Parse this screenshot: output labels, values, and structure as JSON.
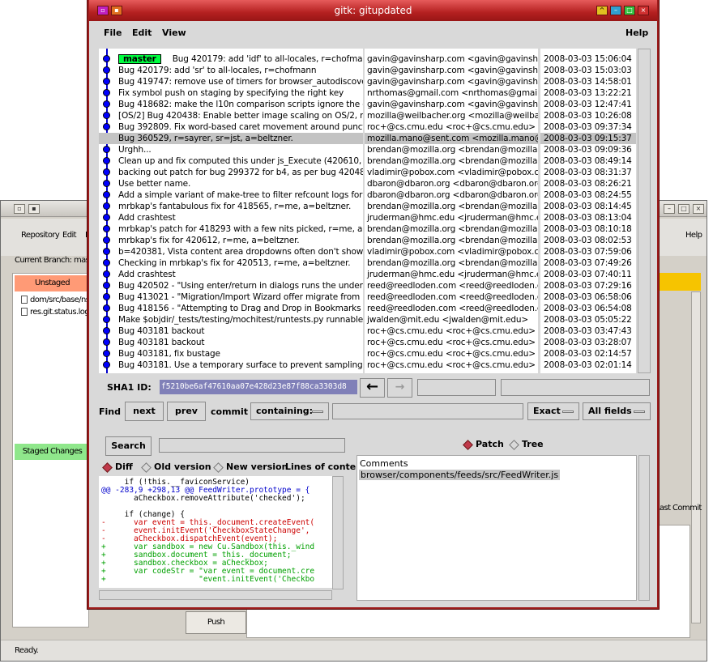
{
  "background_window": {
    "menu": [
      "Repository",
      "Edit",
      "Br",
      "Help"
    ],
    "current_branch_label": "Current Branch:",
    "current_branch": "master",
    "unstaged_header": "Unstaged",
    "unstaged_files": [
      "dom/src/base/nsDOMC",
      "res.git.status.log"
    ],
    "staged_header": "Staged Changes",
    "last_commit_label": "Last Commit",
    "push_label": "Push",
    "status": "Ready."
  },
  "gitk": {
    "title": "gitk: gitupdated",
    "menu": {
      "file": "File",
      "edit": "Edit",
      "view": "View",
      "help": "Help"
    },
    "branch_tag": "master",
    "commits": [
      {
        "msg": "Bug 420179: add 'idf' to all-locales, r=chofmann, a=",
        "author": "gavin@gavinsharp.com <gavin@gavinsharp",
        "date": "2008-03-03 15:06:04"
      },
      {
        "msg": "Bug 420179: add 'sr' to all-locales, r=chofmann",
        "author": "gavin@gavinsharp.com <gavin@gavinsharp",
        "date": "2008-03-03 15:03:03"
      },
      {
        "msg": "Bug 419747: remove use of timers for browser_autodiscovery",
        "author": "gavin@gavinsharp.com <gavin@gavinsharp",
        "date": "2008-03-03 14:58:01"
      },
      {
        "msg": "Fix symbol push on staging by specifying the right key",
        "author": "nrthomas@gmail.com <nrthomas@gmail.co",
        "date": "2008-03-03 13:22:21"
      },
      {
        "msg": "Bug 418682: make the l10n comparison scripts ignore the opt",
        "author": "gavin@gavinsharp.com <gavin@gavinsharp",
        "date": "2008-03-03 12:47:41"
      },
      {
        "msg": "[OS/2] Bug 420438: Enable better image scaling on OS/2, r=w",
        "author": "mozilla@weilbacher.org <mozilla@weilbach",
        "date": "2008-03-03 10:26:08"
      },
      {
        "msg": "Bug 392809. Fix word-based caret movement around punctua",
        "author": "roc+@cs.cmu.edu <roc+@cs.cmu.edu>",
        "date": "2008-03-03 09:37:34"
      },
      {
        "msg": "Bug 360529, r=sayrer, sr=jst, a=beltzner.",
        "author": "mozilla.mano@sent.com <mozilla.mano@se",
        "date": "2008-03-03 09:15:37",
        "selected": true
      },
      {
        "msg": "Urghh...",
        "author": "brendan@mozilla.org <brendan@mozilla.org",
        "date": "2008-03-03 09:09:36"
      },
      {
        "msg": "Clean up and fix computed this under js_Execute (420610, r=",
        "author": "brendan@mozilla.org <brendan@mozilla.org",
        "date": "2008-03-03 08:49:14"
      },
      {
        "msg": "backing out patch for bug 299372 for b4, as per bug 420481",
        "author": "vladimir@pobox.com <vladimir@pobox.com",
        "date": "2008-03-03 08:31:37"
      },
      {
        "msg": "Use better name.",
        "author": "dbaron@dbaron.org <dbaron@dbaron.org>",
        "date": "2008-03-03 08:26:21"
      },
      {
        "msg": "Add a simple variant of make-tree to filter refcount logs for a s",
        "author": "dbaron@dbaron.org <dbaron@dbaron.org>",
        "date": "2008-03-03 08:24:55"
      },
      {
        "msg": "mrbkap's fantabulous fix for 418565, r=me, a=beltzner.",
        "author": "brendan@mozilla.org <brendan@mozilla.org",
        "date": "2008-03-03 08:14:45"
      },
      {
        "msg": "Add crashtest",
        "author": "jruderman@hmc.edu <jruderman@hmc.edu",
        "date": "2008-03-03 08:13:04"
      },
      {
        "msg": "mrbkap's patch for 418293 with a few nits picked, r=me, a=bel",
        "author": "brendan@mozilla.org <brendan@mozilla.org",
        "date": "2008-03-03 08:10:18"
      },
      {
        "msg": "mrbkap's fix for 420612, r=me, a=beltzner.",
        "author": "brendan@mozilla.org <brendan@mozilla.org",
        "date": "2008-03-03 08:02:53"
      },
      {
        "msg": "b=420381, Vista content area dropdowns often don't show dro",
        "author": "vladimir@pobox.com <vladimir@pobox.com",
        "date": "2008-03-03 07:59:06"
      },
      {
        "msg": "Checking in mrbkap's fix for 420513, r=me, a=beltzner.",
        "author": "brendan@mozilla.org <brendan@mozilla.org",
        "date": "2008-03-03 07:49:26"
      },
      {
        "msg": "Add crashtest",
        "author": "jruderman@hmc.edu <jruderman@hmc.edu",
        "date": "2008-03-03 07:40:11"
      },
      {
        "msg": "Bug 420502 - \"Using enter/return in dialogs runs the underlyin",
        "author": "reed@reedloden.com <reed@reedloden.co",
        "date": "2008-03-03 07:29:16"
      },
      {
        "msg": "Bug 413021 - \"Migration/Import Wizard offer migrate from IE d",
        "author": "reed@reedloden.com <reed@reedloden.co",
        "date": "2008-03-03 06:58:06"
      },
      {
        "msg": "Bug 418156 - \"Attempting to Drag and Drop in Bookmarks me",
        "author": "reed@reedloden.com <reed@reedloden.co",
        "date": "2008-03-03 06:54:08"
      },
      {
        "msg": "Make $objdir/_tests/testing/mochitest/runtests.py runnable fro",
        "author": "jwalden@mit.edu <jwalden@mit.edu>",
        "date": "2008-03-03 05:05:22"
      },
      {
        "msg": "Bug 403181 backout",
        "author": "roc+@cs.cmu.edu <roc+@cs.cmu.edu>",
        "date": "2008-03-03 03:47:43"
      },
      {
        "msg": "Bug 403181 backout",
        "author": "roc+@cs.cmu.edu <roc+@cs.cmu.edu>",
        "date": "2008-03-03 03:28:07"
      },
      {
        "msg": "Bug 403181, fix bustage",
        "author": "roc+@cs.cmu.edu <roc+@cs.cmu.edu>",
        "date": "2008-03-03 02:14:57"
      },
      {
        "msg": "Bug 403181. Use a temporary surface to prevent sampling of",
        "author": "roc+@cs.cmu.edu <roc+@cs.cmu.edu>",
        "date": "2008-03-03 02:01:14"
      }
    ],
    "sha_label": "SHA1 ID:",
    "sha_value": "f5210be6af47610aa07e428d23e87f88ca3303d8",
    "find": {
      "label": "Find",
      "next": "next",
      "prev": "prev",
      "commit_label": "commit",
      "containing": "containing:",
      "exact": "Exact",
      "all_fields": "All fields"
    },
    "search_label": "Search",
    "diff_options": {
      "diff": "Diff",
      "old": "Old version",
      "new": "New version",
      "lines": "Lines of conte"
    },
    "view_options": {
      "patch": "Patch",
      "tree": "Tree"
    },
    "diff_lines": [
      {
        "t": "     if (!this.__faviconService)",
        "c": "#000000"
      },
      {
        "t": "@@ -283,9 +298,13 @@ FeedWriter.prototype = {",
        "c": "#0000cc"
      },
      {
        "t": "       aCheckbox.removeAttribute('checked');",
        "c": "#000000"
      },
      {
        "t": "",
        "c": "#000000"
      },
      {
        "t": "     if (change) {",
        "c": "#000000"
      },
      {
        "t": "-      var event = this._document.createEvent(",
        "c": "#cc0000"
      },
      {
        "t": "-      event.initEvent('CheckboxStateChange',",
        "c": "#cc0000"
      },
      {
        "t": "-      aCheckbox.dispatchEvent(event);",
        "c": "#cc0000"
      },
      {
        "t": "+      var sandbox = new Cu.Sandbox(this._wind",
        "c": "#00a000"
      },
      {
        "t": "+      sandbox.document = this._document;",
        "c": "#00a000"
      },
      {
        "t": "+      sandbox.checkbox = aCheckbox;",
        "c": "#00a000"
      },
      {
        "t": "+      var codeStr = \"var event = document.cre",
        "c": "#00a000"
      },
      {
        "t": "+                    \"event.initEvent('Checkbo",
        "c": "#00a000"
      }
    ],
    "comments_label": "Comments",
    "comments_file": "browser/components/feeds/src/FeedWriter.js"
  }
}
